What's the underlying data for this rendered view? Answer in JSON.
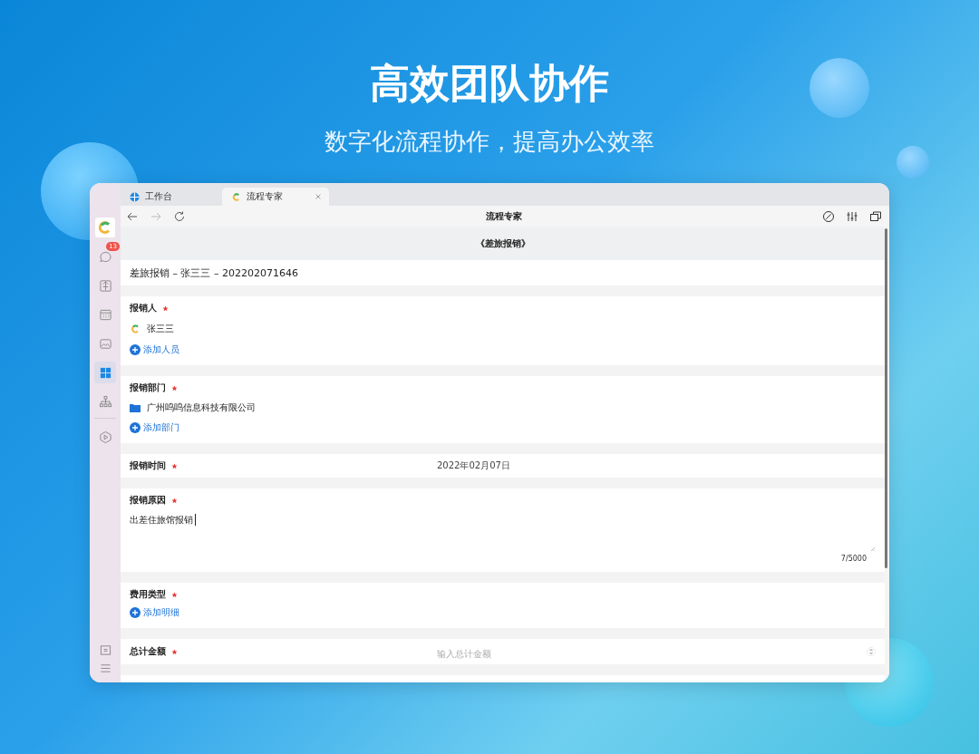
{
  "headline": "高效团队协作",
  "subheadline": "数字化流程协作，提高办公效率",
  "sidebar": {
    "logo": {
      "kind": "logo"
    },
    "items": [
      {
        "kind": "chat",
        "selected": false,
        "badge": "13"
      },
      {
        "kind": "box",
        "selected": false
      },
      {
        "kind": "calendar",
        "selected": false
      },
      {
        "kind": "image",
        "selected": false
      },
      {
        "kind": "grid",
        "selected": true
      },
      {
        "kind": "org",
        "selected": false
      }
    ],
    "items_after_divider": [
      {
        "kind": "hex",
        "selected": false
      }
    ],
    "bottom_items": [
      {
        "kind": "panel"
      },
      {
        "kind": "menu"
      }
    ]
  },
  "tabs": [
    {
      "label": "工作台",
      "kind": "globe",
      "selected": false
    },
    {
      "label": "流程专家",
      "kind": "logo",
      "selected": true
    }
  ],
  "toolbar": {
    "title": "流程专家",
    "nav": [
      {
        "kind": "back",
        "disabled": false
      },
      {
        "kind": "forward",
        "disabled": true
      },
      {
        "kind": "refresh",
        "disabled": false
      }
    ],
    "tools": [
      {
        "kind": "compass"
      },
      {
        "kind": "sliders"
      },
      {
        "kind": "window"
      }
    ]
  },
  "form": {
    "title": "《差旅报销》",
    "record_title": "差旅报销 – 张三三 – 202202071646",
    "fields": [
      {
        "kind": "people",
        "label": "报销人",
        "required": true,
        "people": [
          "张三三"
        ],
        "add_label": "添加人员"
      },
      {
        "kind": "department",
        "label": "报销部门",
        "required": true,
        "departments": [
          "广州呜呜信息科技有限公司"
        ],
        "add_label": "添加部门"
      },
      {
        "kind": "date",
        "label": "报销时间",
        "required": true,
        "value": "2022年02月07日"
      },
      {
        "kind": "textarea",
        "label": "报销原因",
        "required": true,
        "value": "出差住旅馆报销",
        "counter": "7/5000"
      },
      {
        "kind": "detail",
        "label": "费用类型",
        "required": true,
        "add_label": "添加明细"
      },
      {
        "kind": "number",
        "label": "总计金额",
        "required": true,
        "placeholder": "输入总计金额"
      }
    ]
  }
}
